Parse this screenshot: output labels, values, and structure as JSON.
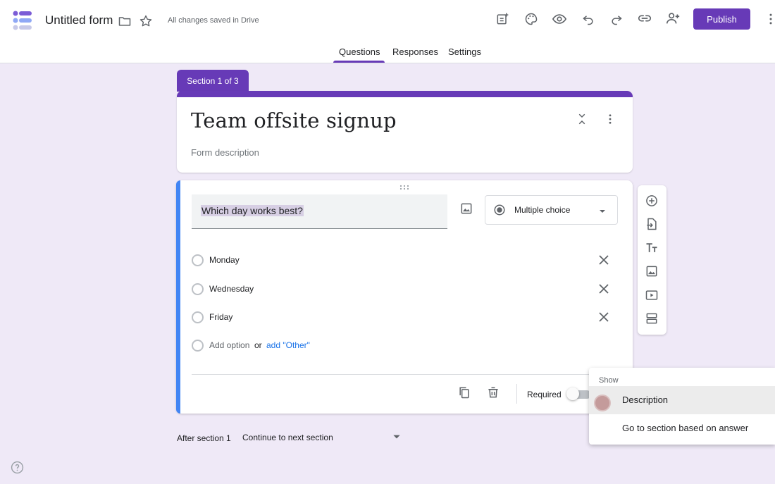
{
  "header": {
    "doc_title": "Untitled form",
    "save_status": "All changes saved in Drive",
    "publish_label": "Publish",
    "icons": [
      "folder-icon",
      "star-icon",
      "addon-icon",
      "palette-icon",
      "preview-icon",
      "undo-icon",
      "redo-icon",
      "link-icon",
      "add-collaborator-icon",
      "more-vert-icon"
    ],
    "accent_color": "#673ab7"
  },
  "tabs": {
    "items": [
      {
        "label": "Questions",
        "active": true
      },
      {
        "label": "Responses",
        "active": false
      },
      {
        "label": "Settings",
        "active": false
      }
    ]
  },
  "section": {
    "tag": "Section 1 of 3",
    "title": "Team offsite signup",
    "description_placeholder": "Form description"
  },
  "question": {
    "text": "Which day works best?",
    "type": "Multiple choice",
    "options": [
      "Monday",
      "Wednesday",
      "Friday"
    ],
    "add_option": "Add option",
    "or": "or",
    "add_other": "add \"Other\"",
    "required_label": "Required",
    "required": false,
    "accent_color": "#4285f4"
  },
  "menu": {
    "header": "Show",
    "items": [
      "Description",
      "Go to section based on answer"
    ]
  },
  "after_section": {
    "label": "After section 1",
    "value": "Continue to next section"
  },
  "toolbar": {
    "icons": [
      "add-question-icon",
      "import-questions-icon",
      "add-title-icon",
      "add-image-icon",
      "add-video-icon",
      "add-section-icon"
    ]
  }
}
